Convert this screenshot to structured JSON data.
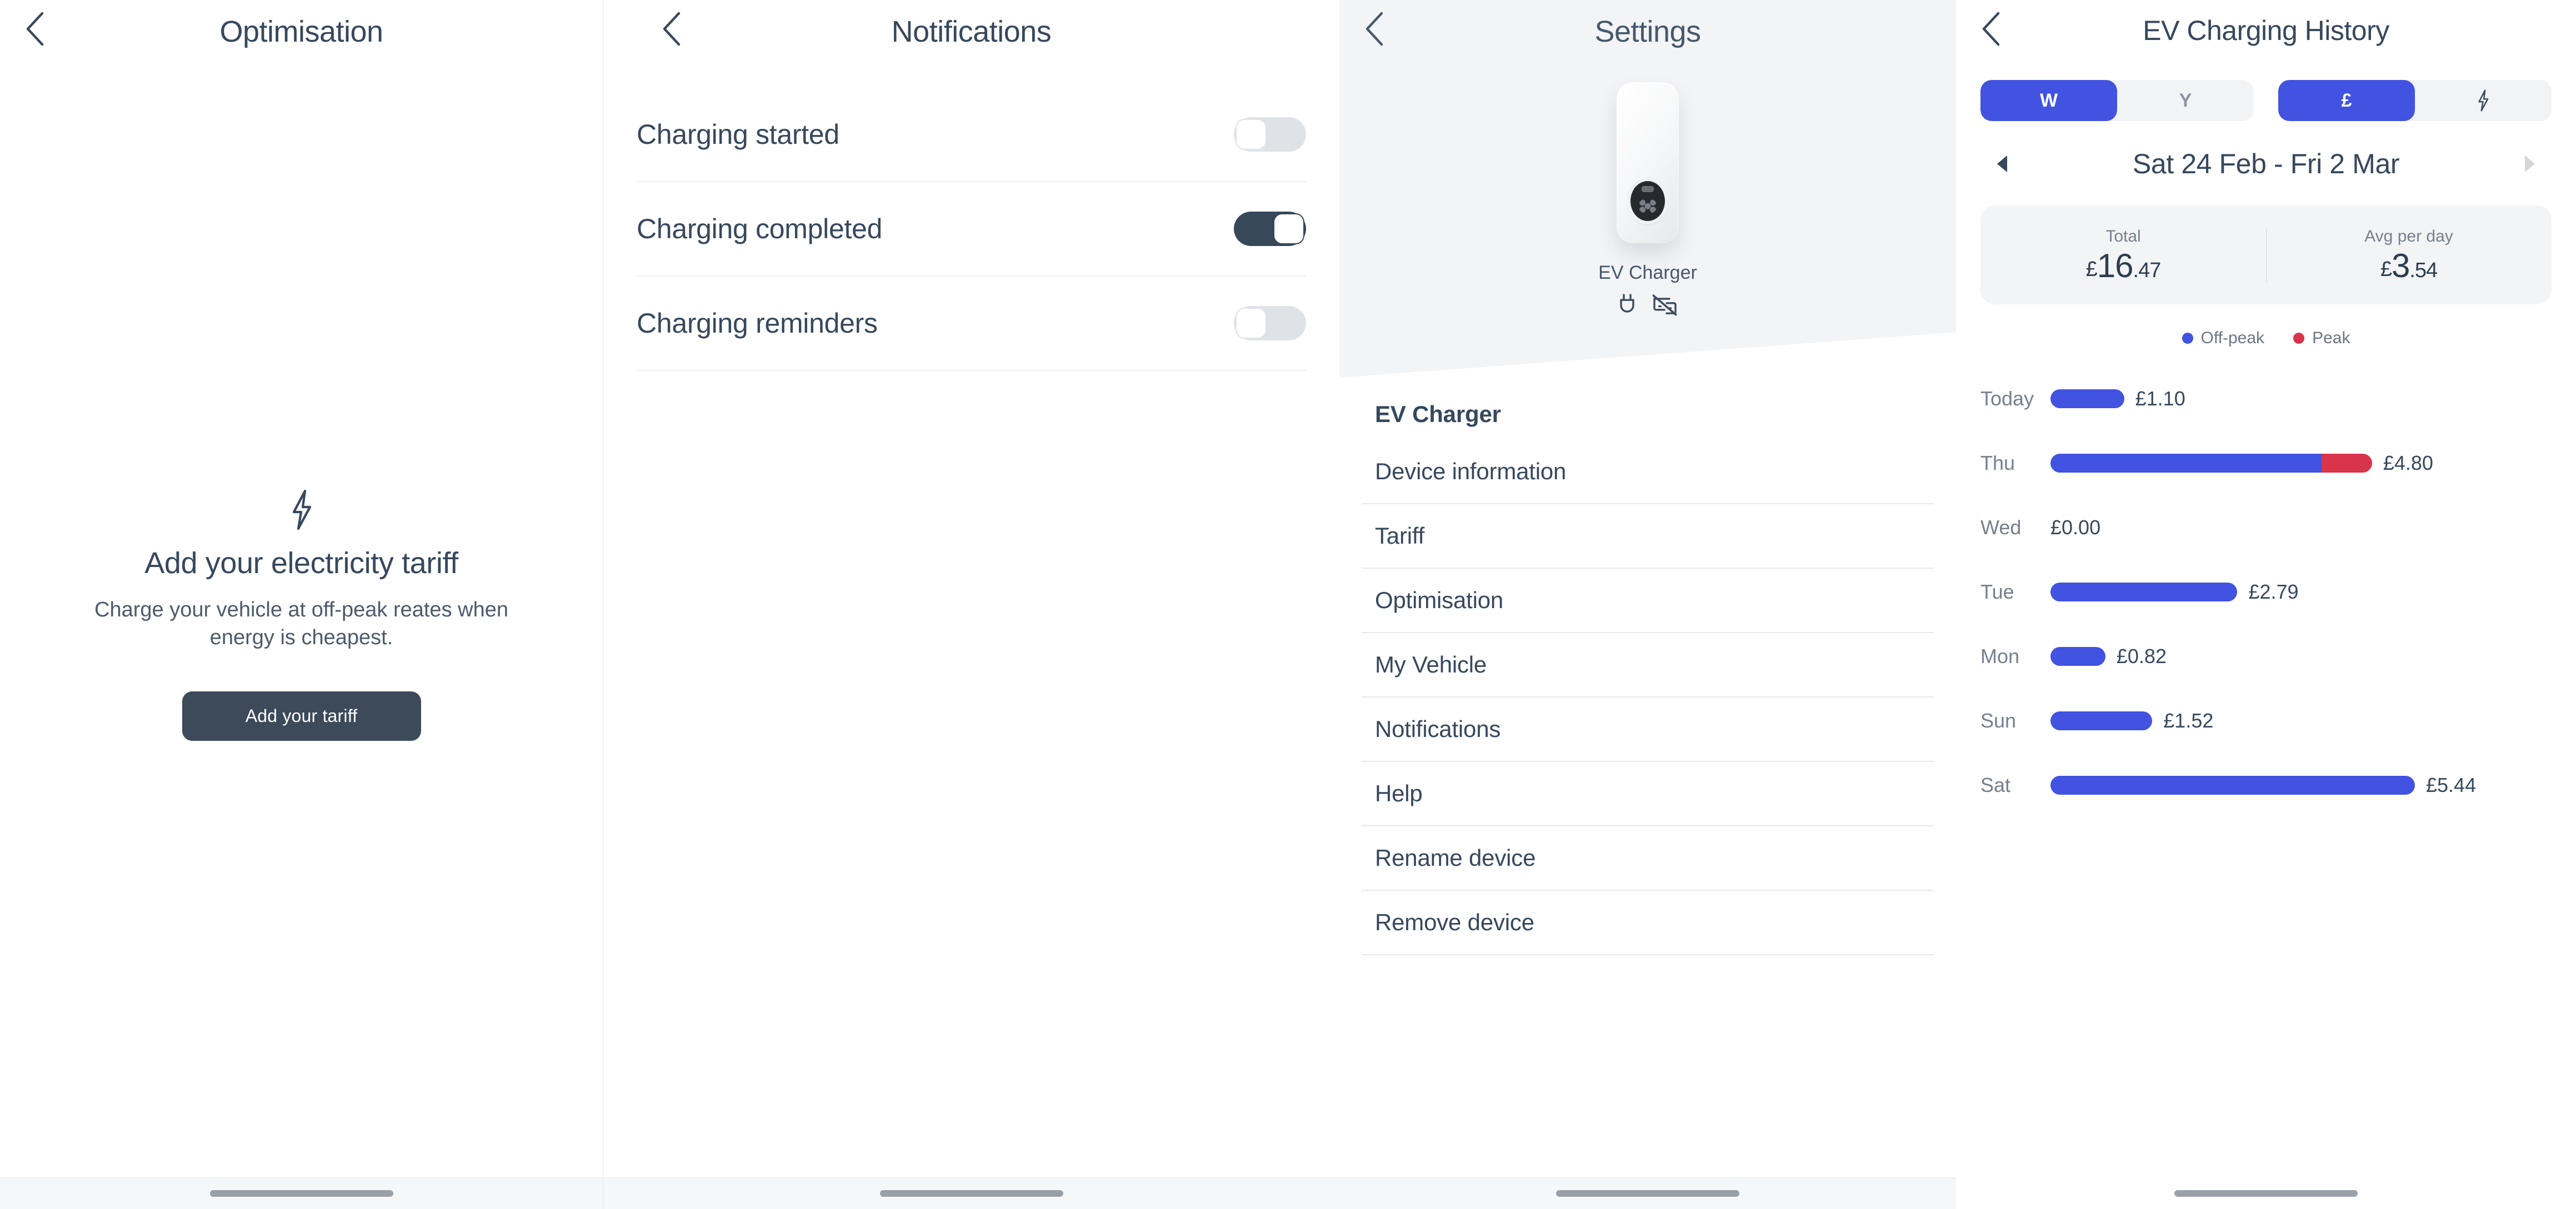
{
  "screens": {
    "optimisation": {
      "nav": {
        "title": "Optimisation",
        "back_icon": "chevron-left-icon"
      },
      "empty_state": {
        "icon": "lightning-bolt-icon",
        "title": "Add your electricity tariff",
        "subtitle": "Charge your vehicle at off-peak reates when energy is cheapest.",
        "button_label": "Add your tariff"
      }
    },
    "notifications": {
      "nav": {
        "title": "Notifications",
        "back_icon": "chevron-left-icon"
      },
      "rows": [
        {
          "label": "Charging started",
          "state": "off"
        },
        {
          "label": "Charging completed",
          "state": "on"
        },
        {
          "label": "Charging reminders",
          "state": "off"
        }
      ]
    },
    "settings": {
      "nav": {
        "title": "Settings",
        "back_icon": "chevron-left-icon"
      },
      "device": {
        "name": "EV Charger",
        "image_name": "ev-charger-device-image",
        "status_icons": [
          "plug-icon",
          "devices-disconnected-icon"
        ]
      },
      "group_header": "EV Charger",
      "items": [
        {
          "label": "Device information"
        },
        {
          "label": "Tariff"
        },
        {
          "label": "Optimisation"
        },
        {
          "label": "My Vehicle"
        },
        {
          "label": "Notifications"
        },
        {
          "label": "Help"
        },
        {
          "label": "Rename device"
        },
        {
          "label": "Remove device"
        }
      ]
    },
    "history": {
      "nav": {
        "title": "EV Charging History",
        "back_icon": "chevron-left-icon"
      },
      "period_toggle": {
        "options": [
          {
            "label": "W",
            "active": true
          },
          {
            "label": "Y",
            "active": false
          }
        ]
      },
      "unit_toggle": {
        "options": [
          {
            "label": "£",
            "active": true,
            "icon": null
          },
          {
            "label": "",
            "active": false,
            "icon": "lightning-bolt-icon"
          }
        ]
      },
      "date_nav": {
        "prev_icon": "triangle-left-icon",
        "next_icon": "triangle-right-icon",
        "range": "Sat 24 Feb - Fri 2 Mar"
      },
      "totals": [
        {
          "label": "Total",
          "currency": "£",
          "whole": "16",
          "decimal": ".47"
        },
        {
          "label": "Avg per day",
          "currency": "£",
          "whole": "3",
          "decimal": ".54"
        }
      ],
      "legend": [
        {
          "label": "Off-peak",
          "color": "#4153e0"
        },
        {
          "label": "Peak",
          "color": "#d8344a"
        }
      ]
    }
  },
  "colors": {
    "accent_blue": "#4153e0",
    "peak_red": "#d8344a",
    "text_dark": "#36485c",
    "toggle_on": "#37485a",
    "button_dark": "#3c4a5a"
  },
  "chart_data": {
    "type": "bar",
    "title": "EV Charging History",
    "subtitle": "Sat 24 Feb - Fri 2 Mar",
    "orientation": "horizontal",
    "stacked": true,
    "unit": "£",
    "xlabel": "",
    "ylabel": "",
    "grid": false,
    "legend_position": "top-center",
    "categories": [
      "Today",
      "Thu",
      "Wed",
      "Tue",
      "Mon",
      "Sun",
      "Sat"
    ],
    "series": [
      {
        "name": "Off-peak",
        "color": "#4153e0",
        "values": [
          1.1,
          4.05,
          0.0,
          2.79,
          0.82,
          1.52,
          5.44
        ]
      },
      {
        "name": "Peak",
        "color": "#d8344a",
        "values": [
          0.0,
          0.75,
          0.0,
          0.0,
          0.0,
          0.0,
          0.0
        ]
      }
    ],
    "totals": [
      1.1,
      4.8,
      0.0,
      2.79,
      0.82,
      1.52,
      5.44
    ],
    "labels": [
      "£1.10",
      "£4.80",
      "£0.00",
      "£2.79",
      "£0.82",
      "£1.52",
      "£5.44"
    ],
    "xlim": [
      0,
      5.44
    ],
    "summary": {
      "total": 16.47,
      "avg_per_day": 3.54
    }
  }
}
